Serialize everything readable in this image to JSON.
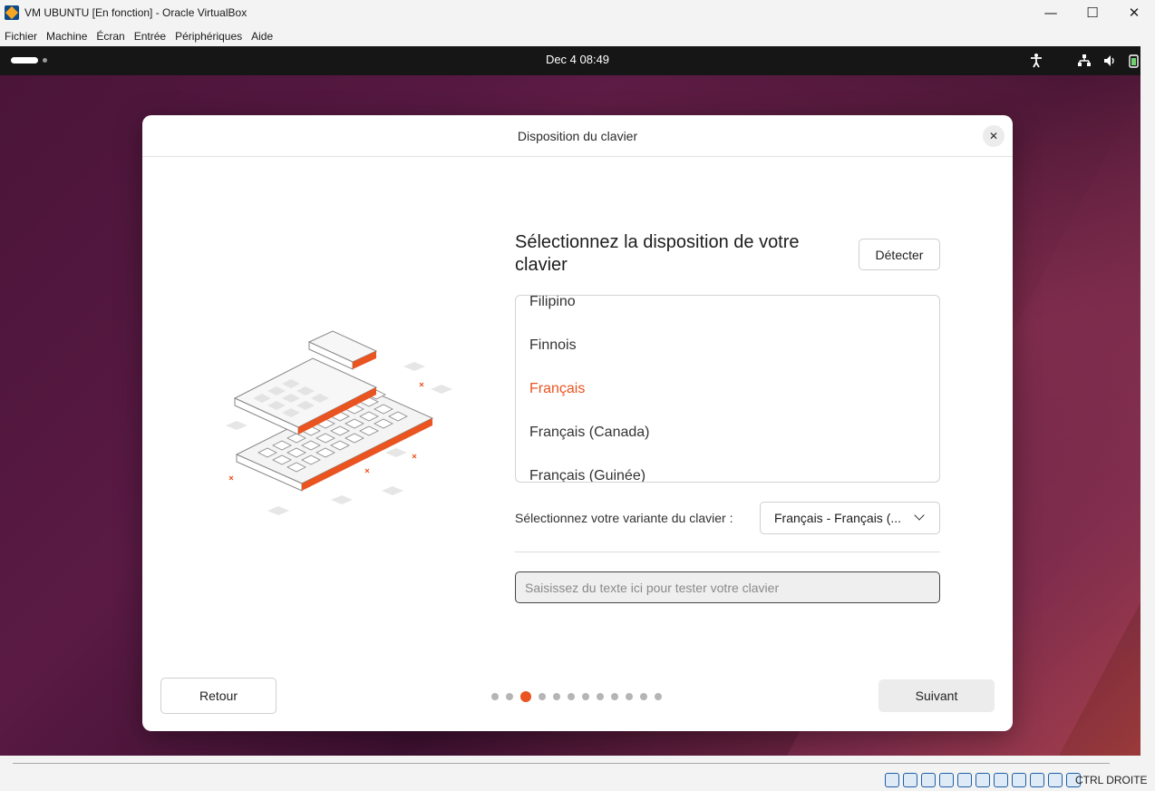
{
  "window": {
    "title": "VM UBUNTU [En fonction] - Oracle VirtualBox",
    "minimize": "—",
    "maximize": "☐",
    "close": "✕"
  },
  "menu": [
    "Fichier",
    "Machine",
    "Écran",
    "Entrée",
    "Périphériques",
    "Aide"
  ],
  "guest_topbar": {
    "clock": "Dec 4  08:49",
    "icons": [
      "accessibility-icon",
      "network-icon",
      "volume-icon",
      "battery-icon"
    ]
  },
  "dialog": {
    "title": "Disposition du clavier",
    "close": "✕",
    "heading": "Sélectionnez la disposition de votre clavier",
    "detect_label": "Détecter",
    "layouts": [
      "Filipino",
      "Finnois",
      "Français",
      "Français (Canada)",
      "Français (Guinée)"
    ],
    "selected_layout": "Français",
    "variant_label": "Sélectionnez votre variante du clavier :",
    "variant_value": "Français - Français (...",
    "test_placeholder": "Saisissez du texte ici pour tester votre clavier",
    "back_label": "Retour",
    "next_label": "Suivant",
    "steps_total": 12,
    "step_current": 3
  },
  "statusbar": {
    "host_key": "CTRL DROITE"
  },
  "colors": {
    "accent": "#e95420",
    "topbar": "#161616"
  }
}
